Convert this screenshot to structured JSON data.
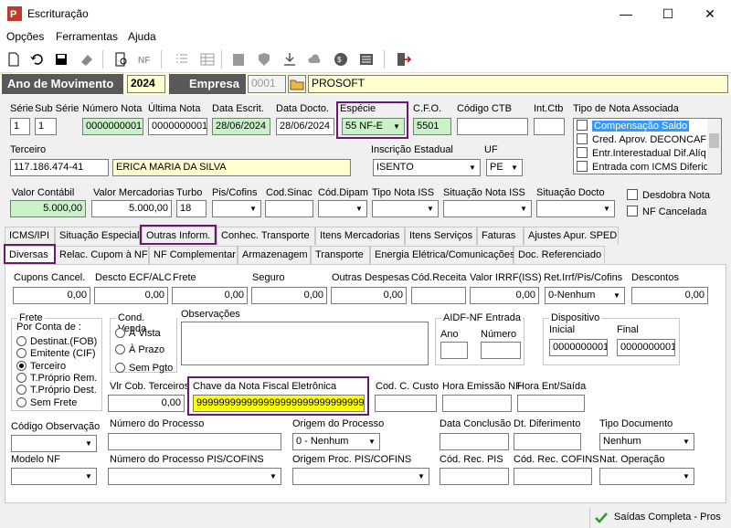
{
  "window": {
    "title": "Escrituração"
  },
  "menu": [
    "Opções",
    "Ferramentas",
    "Ajuda"
  ],
  "year": {
    "label": "Ano de Movimento",
    "value": "2024"
  },
  "empresa": {
    "label": "Empresa",
    "code": "0001",
    "name": "PROSOFT"
  },
  "row1": {
    "serie_lbl": "Série",
    "serie": "1",
    "subserie_lbl": "Sub Série",
    "subserie": "1",
    "numnota_lbl": "Número Nota",
    "numnota": "0000000001",
    "ultnota_lbl": "Última Nota",
    "ultnota": "0000000001",
    "dataescrit_lbl": "Data Escrit.",
    "dataescrit": "28/06/2024",
    "datadocto_lbl": "Data Docto.",
    "datadocto": "28/06/2024",
    "especie_lbl": "Espécie",
    "especie": "55  NF-E",
    "cfo_lbl": "C.F.O.",
    "cfo": "5501",
    "ctb_lbl": "Código CTB",
    "intctb_lbl": "Int.Ctb"
  },
  "tipo_nota": {
    "label": "Tipo de Nota Associada",
    "items": [
      "Compensação Saldo",
      "Cred. Aprov. DECONCAFE",
      "Entr.Interestadual Dif.Alíq",
      "Entrada com ICMS Diferido"
    ]
  },
  "terceiro": {
    "label": "Terceiro",
    "doc": "117.186.474-41",
    "name": "ERICA MARIA DA SILVA",
    "ie_lbl": "Inscrição Estadual",
    "ie": "ISENTO",
    "uf_lbl": "UF",
    "uf": "PE"
  },
  "valores": {
    "vcontabil_lbl": "Valor Contábil",
    "vcontabil": "5.000,00",
    "vmerc_lbl": "Valor Mercadorias",
    "vmerc": "5.000,00",
    "turbo_lbl": "Turbo",
    "turbo": "18",
    "piscofins_lbl": "Pis/Cofins",
    "codsinac_lbl": "Cod.Sinac",
    "coddipam_lbl": "Cód.Dipam",
    "tiponotaiss_lbl": "Tipo Nota ISS",
    "sitnotaiss_lbl": "Situação Nota ISS",
    "sitdocto_lbl": "Situação Docto",
    "desdobra_lbl": "Desdobra Nota",
    "nfcancel_lbl": "NF Cancelada"
  },
  "tabs1": [
    "ICMS/IPI",
    "Situação Especial",
    "Outras Inform.",
    "Conhec. Transporte",
    "Itens Mercadorias",
    "Itens Serviços",
    "Faturas",
    "Ajustes Apur. SPED"
  ],
  "tabs2": [
    "Diversas",
    "Relac. Cupom à NF",
    "NF Complementar",
    "Armazenagem",
    "Transporte",
    "Energia Elétrica/Comunicações",
    "Doc. Referenciado"
  ],
  "diversas": {
    "cupons_lbl": "Cupons Cancel.",
    "cupons": "0,00",
    "descto_lbl": "Descto ECF/ALC",
    "descto": "0,00",
    "frete_lbl": "Frete",
    "frete": "0,00",
    "seguro_lbl": "Seguro",
    "seguro": "0,00",
    "outras_lbl": "Outras Despesas",
    "outras": "0,00",
    "codrec_lbl": "Cód.Receita",
    "irrf_lbl": "Valor IRRF(ISS)",
    "irrf": "0,00",
    "retirrf_lbl": "Ret.Irrf/Pis/Cofins",
    "retirrf": "0-Nenhum",
    "descontos_lbl": "Descontos",
    "descontos": "0,00",
    "frete_grp": "Frete",
    "porconta": "Por Conta de :",
    "frete_opts": [
      "Destinat.(FOB)",
      "Emitente (CIF)",
      "Terceiro",
      "T.Próprio Rem.",
      "T.Próprio Dest.",
      "Sem Frete"
    ],
    "condvenda_grp": "Cond. Venda",
    "condvenda_opts": [
      "À Vista",
      "À Prazo",
      "Sem Pgto"
    ],
    "obs_lbl": "Observações",
    "aidf_grp": "AIDF-NF Entrada",
    "ano_lbl": "Ano",
    "numero_lbl": "Número",
    "disp_grp": "Dispositivo",
    "inicial_lbl": "Inicial",
    "inicial": "0000000001",
    "final_lbl": "Final",
    "final": "0000000001",
    "vlrcob_lbl": "Vlr Cob. Terceiros",
    "vlrcob": "0,00",
    "chave_lbl": "Chave da Nota Fiscal Eletrônica",
    "chave": "99999999999999999999999999999999999999999999",
    "codcusto_lbl": "Cod. C. Custo",
    "horaemis_lbl": "Hora Emissão NF",
    "horaent_lbl": "Hora Ent/Saída",
    "codobs_lbl": "Código Observação",
    "numproc_lbl": "Número do Processo",
    "origproc_lbl": "Origem do Processo",
    "origproc": "0 - Nenhum",
    "dataconc_lbl": "Data Conclusão",
    "dtdif_lbl": "Dt. Diferimento",
    "tipodoc_lbl": "Tipo Documento",
    "tipodoc": "Nenhum",
    "modelonf_lbl": "Modelo NF",
    "numprocpis_lbl": "Número do Processo PIS/COFINS",
    "origprocpis_lbl": "Origem Proc. PIS/COFINS",
    "codrecpis_lbl": "Cód. Rec. PIS",
    "codreccofins_lbl": "Cód. Rec. COFINS",
    "natop_lbl": "Nat. Operação"
  },
  "status": {
    "text": "Saídas Completa - Pros"
  },
  "colors": {
    "highlight": "#6a1a6e",
    "green_field": "#c9f2c9",
    "yellow_field": "#ffffd0",
    "dark_label": "#595959",
    "selected": "#3399ff"
  }
}
